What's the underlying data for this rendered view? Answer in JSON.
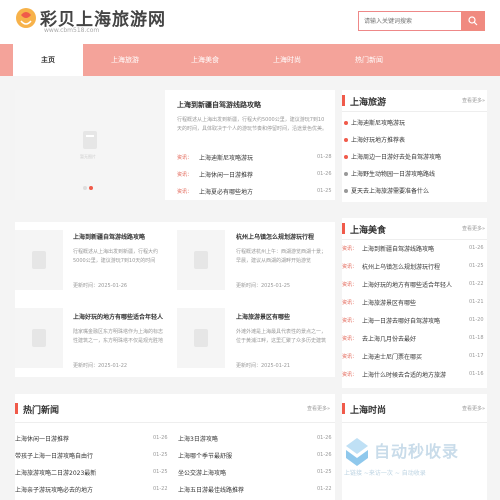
{
  "site": {
    "logo": "彩贝上海旅游网",
    "url": "www.cbm518.com"
  },
  "search": {
    "placeholder": "请输入关键词搜索"
  },
  "nav": [
    "主页",
    "上海旅游",
    "上海美食",
    "上海时尚",
    "热门新闻"
  ],
  "featured": {
    "headline": "上海到新疆自驾游线路攻略",
    "desc": "行程概述从上海出发到新疆，行程大约5000公里，建议游玩7到10天的时间，具体取决于个人的游玩节奏和停留时间，沿途景色优美。",
    "list": [
      {
        "tag": "资讯：",
        "title": "上海迪斯尼攻略游玩",
        "date": "01-28"
      },
      {
        "tag": "资讯：",
        "title": "上海休闲一日游推荐",
        "date": "01-26"
      },
      {
        "tag": "资讯：",
        "title": "上海夏必有哪些地方",
        "date": "01-25"
      }
    ]
  },
  "articles": [
    {
      "title": "上海到新疆自驾游线路攻略",
      "desc": "行程概述从上海出发到新疆，行程大约5000公里，建议游玩7到10天的时间",
      "date": "更新时间：2025-01-26"
    },
    {
      "title": "杭州上乌镇怎么规划游玩行程",
      "desc": "行程概述杭州上午：西湖游览西湖十景；早晨，建议从西湖的湖畔开始游览",
      "date": "更新时间：2025-01-25"
    },
    {
      "title": "上海好玩的地方有哪些适合年轻人",
      "desc": "陆家嘴金融区东方明珠塔作为上海的标志性建筑之一，东方明珠塔不仅是观光胜地",
      "date": "更新时间：2025-01-22"
    },
    {
      "title": "上海旅游景区有哪些",
      "desc": "外滩外滩是上海最具代表性的景点之一，位于黄浦江畔，这里汇聚了众多历史建筑",
      "date": "更新时间：2025-01-21"
    }
  ],
  "placeholder_caption": "暂无图片",
  "hot": {
    "title": "热门新闻",
    "more": "查看更多»",
    "left": [
      {
        "title": "上海休闲一日游推荐",
        "date": "01-26"
      },
      {
        "title": "带孩子上海一日游攻略自由行",
        "date": "01-25"
      },
      {
        "title": "上海旅游攻略二日游2023最新",
        "date": "01-25"
      },
      {
        "title": "上海亲子游玩攻略必去的地方",
        "date": "01-22"
      }
    ],
    "right": [
      {
        "title": "上海3日游攻略",
        "date": "01-26"
      },
      {
        "title": "上海哪个季节最舒服",
        "date": "01-26"
      },
      {
        "title": "坐公交游上海攻略",
        "date": "01-25"
      },
      {
        "title": "上海五日游最佳线路推荐",
        "date": "01-22"
      }
    ]
  },
  "side_travel": {
    "title": "上海旅游",
    "more": "查看更多»",
    "items": [
      {
        "title": "上海迪斯尼攻略游玩",
        "highlight": true
      },
      {
        "title": "上海好玩地方推荐表",
        "highlight": true
      },
      {
        "title": "上海周边一日游好去处自驾游攻略",
        "highlight": true
      },
      {
        "title": "上海野生动物园一日游攻略路线",
        "highlight": false
      },
      {
        "title": "夏天去上海旅游需要准备什么",
        "highlight": false
      }
    ]
  },
  "side_food": {
    "title": "上海美食",
    "more": "查看更多»",
    "items": [
      {
        "tag": "资讯：",
        "title": "上海到新疆自驾游线路攻略",
        "date": "01-26"
      },
      {
        "tag": "资讯：",
        "title": "杭州上乌镇怎么规划游玩行程",
        "date": "01-25"
      },
      {
        "tag": "资讯：",
        "title": "上海好玩的地方有哪些适合年轻人",
        "date": "01-22"
      },
      {
        "tag": "资讯：",
        "title": "上海旅游景区有哪些",
        "date": "01-21"
      },
      {
        "tag": "资讯：",
        "title": "上海一日游去哪好自驾游攻略",
        "date": "01-20"
      },
      {
        "tag": "资讯：",
        "title": "去上海几月份去最好",
        "date": "01-18"
      },
      {
        "tag": "资讯：",
        "title": "上海迪士尼门票在哪买",
        "date": "01-17"
      },
      {
        "tag": "资讯：",
        "title": "上海什么时候去合适的地方旅游",
        "date": "01-16"
      }
    ]
  },
  "side_fashion": {
    "title": "上海时尚",
    "more": "查看更多»"
  },
  "watermark": {
    "main": "自动秒收录",
    "sub": "上链接 ~来访一次 ~ 自动收录"
  },
  "colors": {
    "accent": "#f05a4a",
    "nav": "#f4a39a",
    "tag": "#e05a4a"
  }
}
